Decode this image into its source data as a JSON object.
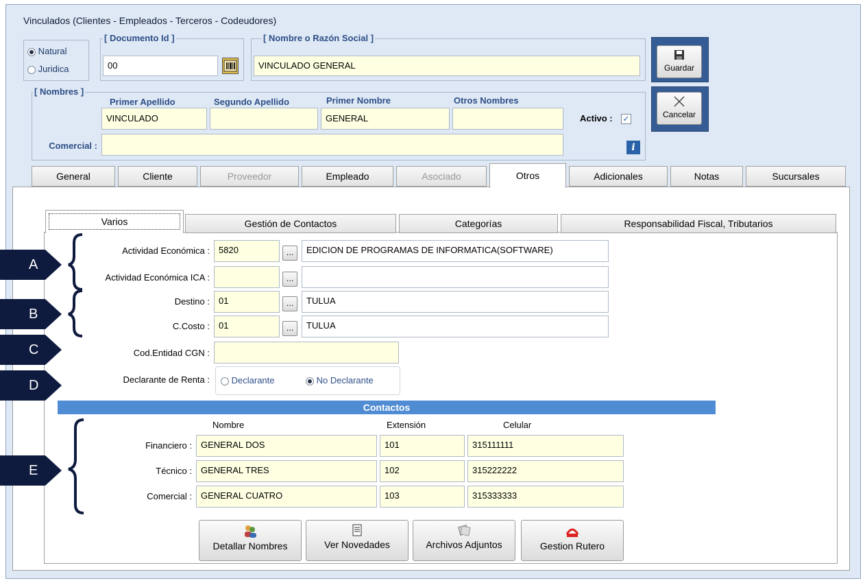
{
  "window": {
    "title": "Vinculados   (Clientes - Empleados - Terceros - Codeudores)"
  },
  "tipo": {
    "natural": "Natural",
    "juridica": "Juridica",
    "selected": "Natural"
  },
  "documento": {
    "label": "[ Documento Id ]",
    "value": "00"
  },
  "razon_social": {
    "label": "[ Nombre o Razón Social ]",
    "value": "VINCULADO GENERAL"
  },
  "actions": {
    "guardar": "Guardar",
    "cancelar": "Cancelar"
  },
  "nombres": {
    "label": "[ Nombres ]",
    "primer_apellido_label": "Primer Apellido",
    "primer_apellido": "VINCULADO",
    "segundo_apellido_label": "Segundo Apellido",
    "segundo_apellido": "",
    "primer_nombre_label": "Primer Nombre",
    "primer_nombre": "GENERAL",
    "otros_nombres_label": "Otros Nombres",
    "otros_nombres": "",
    "comercial_label": "Comercial :",
    "comercial": "",
    "activo_label": "Activo :",
    "activo": true
  },
  "tabs": [
    {
      "label": "General",
      "enabled": true
    },
    {
      "label": "Cliente",
      "enabled": true
    },
    {
      "label": "Proveedor",
      "enabled": false
    },
    {
      "label": "Empleado",
      "enabled": true
    },
    {
      "label": "Asociado",
      "enabled": false
    },
    {
      "label": "Otros",
      "enabled": true,
      "active": true
    },
    {
      "label": "Adicionales",
      "enabled": true
    },
    {
      "label": "Notas",
      "enabled": true
    },
    {
      "label": "Sucursales",
      "enabled": true
    }
  ],
  "subtabs": [
    {
      "label": "Varios",
      "active": true
    },
    {
      "label": "Gestión de Contactos"
    },
    {
      "label": "Categorías"
    },
    {
      "label": "Responsabilidad Fiscal, Tributarios"
    }
  ],
  "varios": {
    "actividad_label": "Actividad Económica :",
    "actividad_code": "5820",
    "actividad_desc": "EDICION DE PROGRAMAS DE INFORMATICA(SOFTWARE)",
    "actividad_ica_label": "Actividad Económica ICA :",
    "actividad_ica_code": "",
    "actividad_ica_desc": "",
    "destino_label": "Destino :",
    "destino_code": "01",
    "destino_desc": "TULUA",
    "ccosto_label": "C.Costo :",
    "ccosto_code": "01",
    "ccosto_desc": "TULUA",
    "cgn_label": "Cod.Entidad CGN :",
    "cgn": "",
    "renta_label": "Declarante de Renta :",
    "declarante": "Declarante",
    "no_declarante": "No Declarante",
    "renta_selected": "No Declarante",
    "ellipsis": "..."
  },
  "contactos": {
    "title": "Contactos",
    "col_nombre": "Nombre",
    "col_extension": "Extensión",
    "col_celular": "Celular",
    "rows": [
      {
        "label": "Financiero :",
        "nombre": "GENERAL DOS",
        "extension": "101",
        "celular": "315111111"
      },
      {
        "label": "Técnico :",
        "nombre": "GENERAL TRES",
        "extension": "102",
        "celular": "315222222"
      },
      {
        "label": "Comercial :",
        "nombre": "GENERAL CUATRO",
        "extension": "103",
        "celular": "315333333"
      }
    ]
  },
  "bottom_buttons": [
    {
      "label": "Detallar Nombres",
      "icon": "users-icon"
    },
    {
      "label": "Ver Novedades",
      "icon": "document-icon"
    },
    {
      "label": "Archivos Adjuntos",
      "icon": "attachment-icon"
    },
    {
      "label": "Gestion Rutero",
      "icon": "pdf-icon"
    }
  ],
  "markers": [
    "A",
    "B",
    "C",
    "D",
    "E"
  ],
  "colors": {
    "accent": "#355c95",
    "marker": "#0e1a3e",
    "field": "#ffffe2",
    "window": "#dfe9f5",
    "contactos_bar": "#4f8cd3"
  }
}
